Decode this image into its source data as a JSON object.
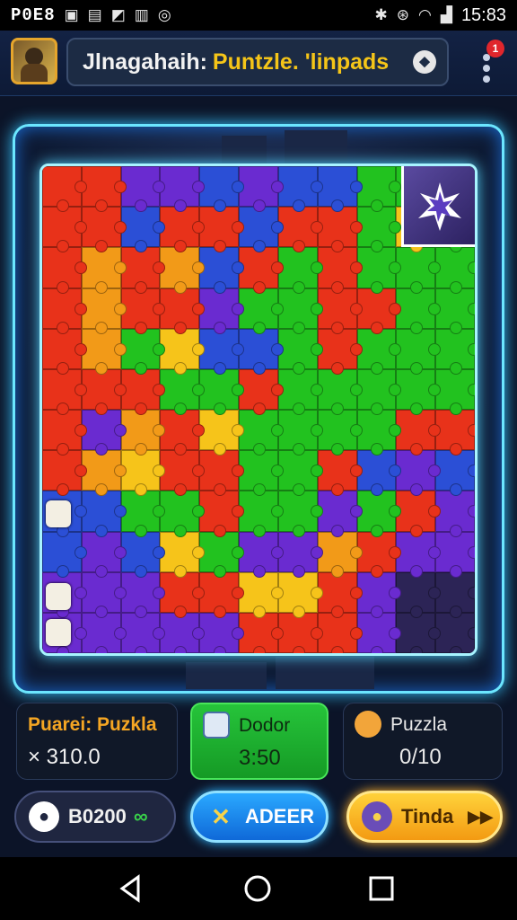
{
  "status_bar": {
    "carrier": "P0E8",
    "time": "15:83",
    "icons": [
      "notification-icon",
      "image-icon",
      "gallery-icon",
      "download-icon",
      "sync-icon",
      "bluetooth-icon",
      "alarm-icon",
      "wifi-icon",
      "signal-icon"
    ]
  },
  "header": {
    "title_part1": "Jlnagahaih:",
    "title_part2": "Puntzle. 'linpads",
    "notification_badge": "1",
    "help_glyph": "◆"
  },
  "board": {
    "colors": {
      "R": "#e8321a",
      "O": "#f29a18",
      "G": "#22c21f",
      "P": "#6a2bd0",
      "B": "#2b4fd6",
      "Y": "#f6c41a",
      "D": "#2c2456"
    },
    "rows": [
      "RRPPBPBBGGG",
      "RRBRRBRRGYG",
      "ROROBRGRGGG",
      "RORRPGGRRGG",
      "ROGYBBGRGGG",
      "RRRGGRGGGGG",
      "RPORYGGGGRR",
      "ROYRRGGRBPB",
      "BBGGRGGPGRP",
      "BPBYGPPORPP",
      "PPPRRYYRPDD",
      "PPPPPRRRPDD"
    ]
  },
  "stats": {
    "puzzle": {
      "label": "Puarei: Puzkla",
      "value": "× 310.0"
    },
    "dodor": {
      "label": "Dodor",
      "value": "3:50"
    },
    "puzzla": {
      "label": "Puzzla",
      "value": "0/10"
    }
  },
  "buttons": {
    "b1": {
      "label": "B0200",
      "extra": "∞"
    },
    "b2": {
      "label": "ADEER"
    },
    "b3": {
      "label": "Tinda",
      "extra": "▶▶"
    }
  }
}
